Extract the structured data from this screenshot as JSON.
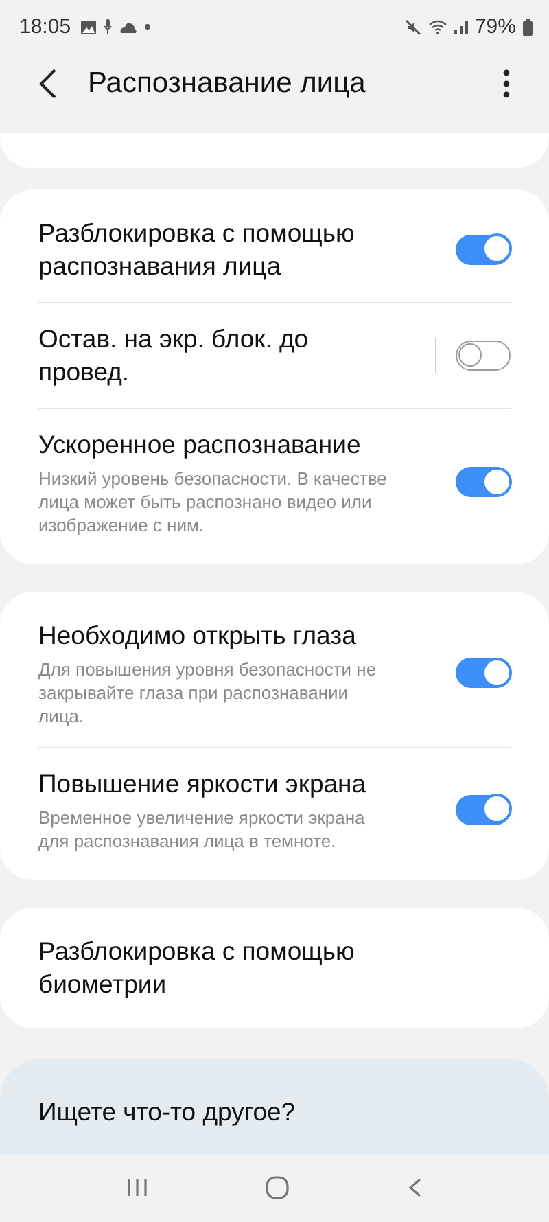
{
  "status_bar": {
    "time": "18:05",
    "battery": "79%"
  },
  "app_bar": {
    "title": "Распознавание лица"
  },
  "groups": [
    {
      "items": [
        {
          "title": "Разблокировка с помощью распознавания лица",
          "on": true,
          "split": false
        },
        {
          "title": "Остав. на экр. блок. до провед.",
          "on": false,
          "split": true
        },
        {
          "title": "Ускоренное распознавание",
          "subtitle": "Низкий уровень безопасности. В качестве лица может быть распознано видео или изображение с ним.",
          "on": true,
          "split": false
        }
      ]
    },
    {
      "items": [
        {
          "title": "Необходимо открыть глаза",
          "subtitle": "Для повышения уровня безопасности не закрывайте глаза при распознавании лица.",
          "on": true,
          "split": false
        },
        {
          "title": "Повышение яркости экрана",
          "subtitle": "Временное увеличение яркости экрана для распознавания лица в темноте.",
          "on": true,
          "split": false
        }
      ]
    },
    {
      "items": [
        {
          "title": "Разблокировка с помощью биометрии"
        }
      ]
    }
  ],
  "search_card": {
    "title": "Ищете что-то другое?"
  }
}
